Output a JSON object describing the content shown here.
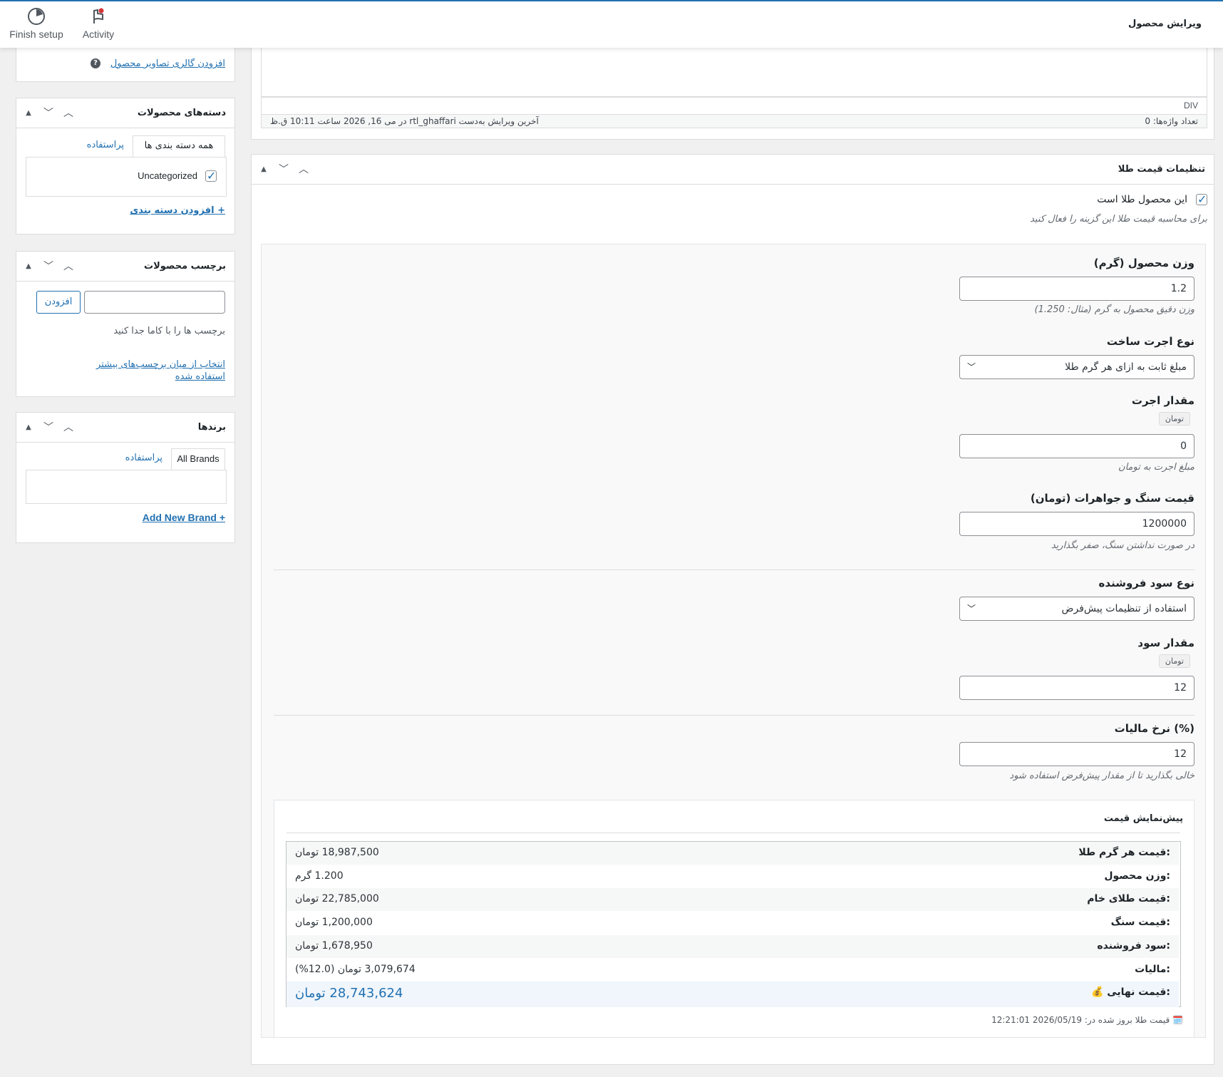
{
  "topbar": {
    "finish_setup": "Finish setup",
    "activity": "Activity",
    "page_heading": "ویرایش محصول"
  },
  "gallery": {
    "link": "افزودن گالری تصاویر محصول"
  },
  "categories": {
    "title": "دسته‌های محصولات",
    "tab_all": "همه دسته بندی ها",
    "tab_popular": "پراستفاده",
    "items": [
      {
        "label": "Uncategorized",
        "checked": true
      }
    ],
    "add_link": "+ افزودن دسته بندی"
  },
  "tags": {
    "title": "برچسب محصولات",
    "add_button": "افزودن",
    "hint": "برچسب ها را با کاما جدا کنید",
    "choose_link": "انتخاب از میان برچسب‌های بیشتر استفاده شده"
  },
  "brands": {
    "title": "برندها",
    "tab_all": "All Brands",
    "tab_popular": "پراستفاده",
    "add_link": "Add New Brand +"
  },
  "editor": {
    "path": "DIV",
    "word_count": "تعداد واژه‌ها: 0",
    "last_edit": "آخرین ویرایش به‌دست rtl_ghaffari در می 16, 2026 ساعت 10:11 ق.ظ"
  },
  "gold": {
    "title": "تنظیمات قیمت طلا",
    "is_gold_label": "این محصول طلا است",
    "is_gold_checked": true,
    "is_gold_hint": "برای محاسبه قیمت طلا این گزینه را فعال کنید",
    "weight_label": "وزن محصول (گرم)",
    "weight_value": "1.2",
    "weight_hint": "وزن دقیق محصول به گرم (مثال: 1.250)",
    "wage_type_label": "نوع اجرت ساخت",
    "wage_type_value": "مبلغ ثابت به ازای هر گرم طلا",
    "wage_amount_label": "مقدار اجرت",
    "wage_unit": "تومان",
    "wage_amount_value": "0",
    "wage_hint": "مبلغ اجرت به تومان",
    "stone_label": "قیمت سنگ و جواهرات (تومان)",
    "stone_value": "1200000",
    "stone_hint": "در صورت نداشتن سنگ، صفر بگذارید",
    "profit_type_label": "نوع سود فروشنده",
    "profit_type_value": "استفاده از تنظیمات پیش‌فرض",
    "profit_amount_label": "مقدار سود",
    "profit_unit": "تومان",
    "profit_amount_value": "12",
    "tax_label": "نرخ مالیات (%)",
    "tax_value": "12",
    "tax_hint": "خالی بگذارید تا از مقدار پیش‌فرض استفاده شود"
  },
  "preview": {
    "title": "پیش‌نمایش قیمت",
    "rows": [
      {
        "label": "قیمت هر گرم طلا:",
        "value": "18,987,500 تومان"
      },
      {
        "label": "وزن محصول:",
        "value": "1.200 گرم"
      },
      {
        "label": "قیمت طلای خام:",
        "value": "22,785,000 تومان"
      },
      {
        "label": "قیمت سنگ:",
        "value": "1,200,000 تومان"
      },
      {
        "label": "سود فروشنده:",
        "value": "1,678,950 تومان"
      },
      {
        "label": "مالیات:",
        "value": "3,079,674 تومان (12.0%)"
      }
    ],
    "final_label": "💰 قیمت نهایی:",
    "final_value": "28,743,624 تومان",
    "updated": "🗓️ قیمت طلا بروز شده در: 2026/05/19 12:21:01"
  }
}
